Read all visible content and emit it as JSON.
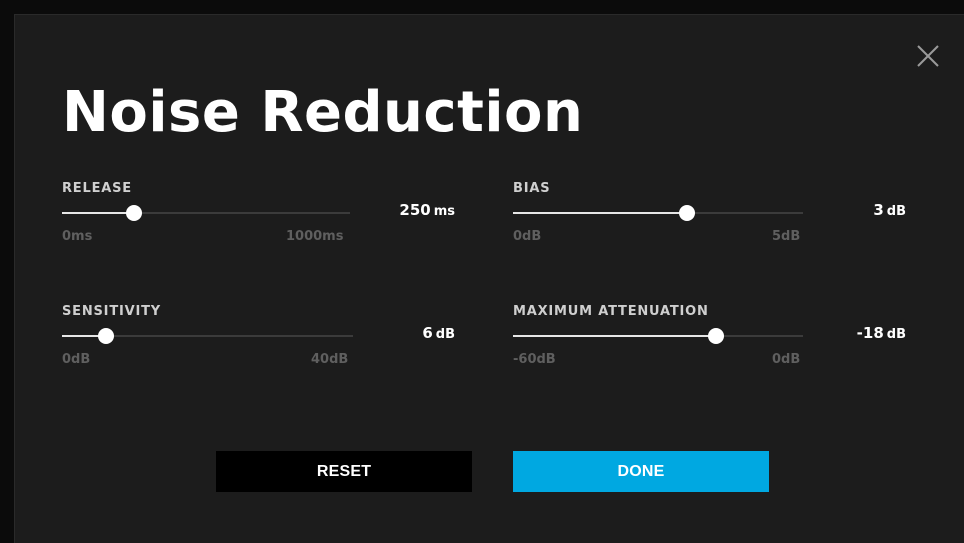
{
  "dialog": {
    "title": "Noise Reduction",
    "close_icon": "close-icon"
  },
  "sliders": {
    "release": {
      "label": "RELEASE",
      "value": "250",
      "unit": "ms",
      "min_label": "0ms",
      "max_label": "1000ms",
      "fraction": 0.25
    },
    "bias": {
      "label": "BIAS",
      "value": "3",
      "unit": "dB",
      "min_label": "0dB",
      "max_label": "5dB",
      "fraction": 0.6
    },
    "sensitivity": {
      "label": "SENSITIVITY",
      "value": "6",
      "unit": "dB",
      "min_label": "0dB",
      "max_label": "40dB",
      "fraction": 0.15
    },
    "max_attenuation": {
      "label": "MAXIMUM ATTENUATION",
      "value": "-18",
      "unit": "dB",
      "min_label": "-60dB",
      "max_label": "0dB",
      "fraction": 0.7
    }
  },
  "buttons": {
    "reset": "RESET",
    "done": "DONE"
  },
  "colors": {
    "accent": "#00a8e1",
    "background": "#1c1c1c"
  }
}
